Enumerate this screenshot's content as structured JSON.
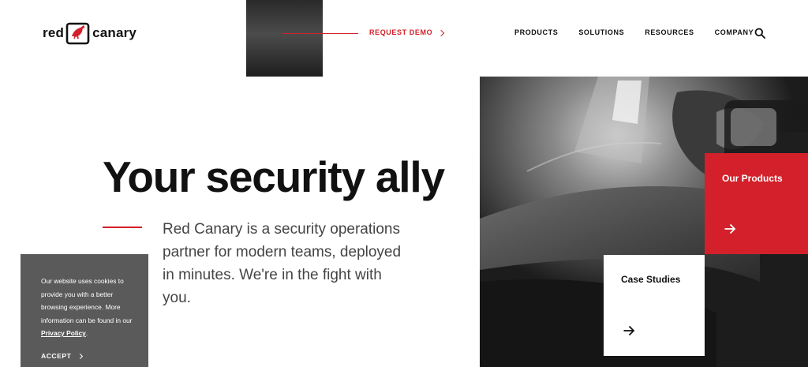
{
  "brand": {
    "word_left": "red",
    "word_right": "canary",
    "accent": "#d3202a"
  },
  "header": {
    "request_demo": "REQUEST DEMO",
    "nav": [
      "PRODUCTS",
      "SOLUTIONS",
      "RESOURCES",
      "COMPANY"
    ],
    "search_icon": "search-icon"
  },
  "hero": {
    "title": "Your security ally",
    "description": "Red Canary is a security operations partner for modern teams, deployed in minutes. We're in the fight with you."
  },
  "cards": {
    "products_label": "Our Products",
    "case_studies_label": "Case Studies",
    "arrow_icon": "arrow-right-icon"
  },
  "cookie": {
    "text_before": "Our website uses cookies to provide you with a better browsing experience. More information can be found in our ",
    "link": "Privacy Policy",
    "text_after": ".",
    "accept": "ACCEPT"
  }
}
